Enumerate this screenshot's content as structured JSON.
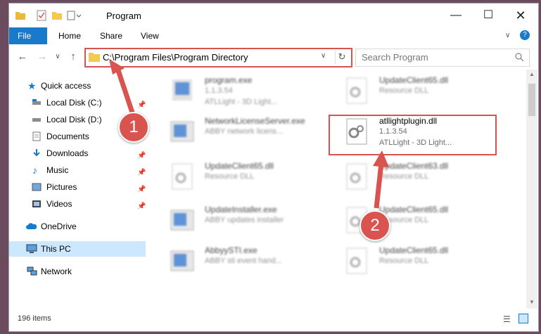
{
  "window": {
    "title": "Program"
  },
  "ribbon": {
    "tabs": [
      "File",
      "Home",
      "Share",
      "View"
    ]
  },
  "address": {
    "path": "C:\\Program Files\\Program Directory",
    "search_placeholder": "Search Program"
  },
  "sidebar": {
    "items": [
      {
        "label": "Quick access",
        "icon": "star-icon",
        "pinned": false
      },
      {
        "label": "Local Disk (C:)",
        "icon": "drive-icon",
        "pinned": true
      },
      {
        "label": "Local Disk (D:)",
        "icon": "drive-icon",
        "pinned": false
      },
      {
        "label": "Documents",
        "icon": "documents-icon",
        "pinned": false
      },
      {
        "label": "Downloads",
        "icon": "download-icon",
        "pinned": true
      },
      {
        "label": "Music",
        "icon": "music-icon",
        "pinned": true
      },
      {
        "label": "Pictures",
        "icon": "pictures-icon",
        "pinned": true
      },
      {
        "label": "Videos",
        "icon": "videos-icon",
        "pinned": true
      },
      {
        "label": "OneDrive",
        "icon": "cloud-icon",
        "pinned": false
      },
      {
        "label": "This PC",
        "icon": "computer-icon",
        "pinned": false
      },
      {
        "label": "Network",
        "icon": "network-icon",
        "pinned": false
      }
    ]
  },
  "files": [
    {
      "name": "program.exe",
      "version": "1.1.3.54",
      "desc": "ATLLight - 3D Light..."
    },
    {
      "name": "UpdateClient65.dll",
      "version": "Resource DLL",
      "desc": ""
    },
    {
      "name": "NetworkLicenseServer.exe",
      "version": "ABBY network licens...",
      "desc": ""
    },
    {
      "name": "atllightplugin.dll",
      "version": "1.1.3.54",
      "desc": "ATLLight - 3D Light..."
    },
    {
      "name": "UpdateClient65.dll",
      "version": "Resource DLL",
      "desc": ""
    },
    {
      "name": "UpdateClient63.dll",
      "version": "Resource DLL",
      "desc": ""
    },
    {
      "name": "UpdateInstaller.exe",
      "version": "ABBY updates installer",
      "desc": ""
    },
    {
      "name": "UpdateClient65.dll",
      "version": "Resource DLL",
      "desc": ""
    },
    {
      "name": "AbbyySTI.exe",
      "version": "ABBY sti event hand...",
      "desc": ""
    },
    {
      "name": "UpdateClient65.dll",
      "version": "Resource DLL",
      "desc": ""
    }
  ],
  "annotations": {
    "step1": "1",
    "step2": "2"
  },
  "status": {
    "items": "196 items"
  },
  "colors": {
    "accent": "#1979ca",
    "annotation": "#d9534f",
    "selected": "#cce8ff"
  }
}
